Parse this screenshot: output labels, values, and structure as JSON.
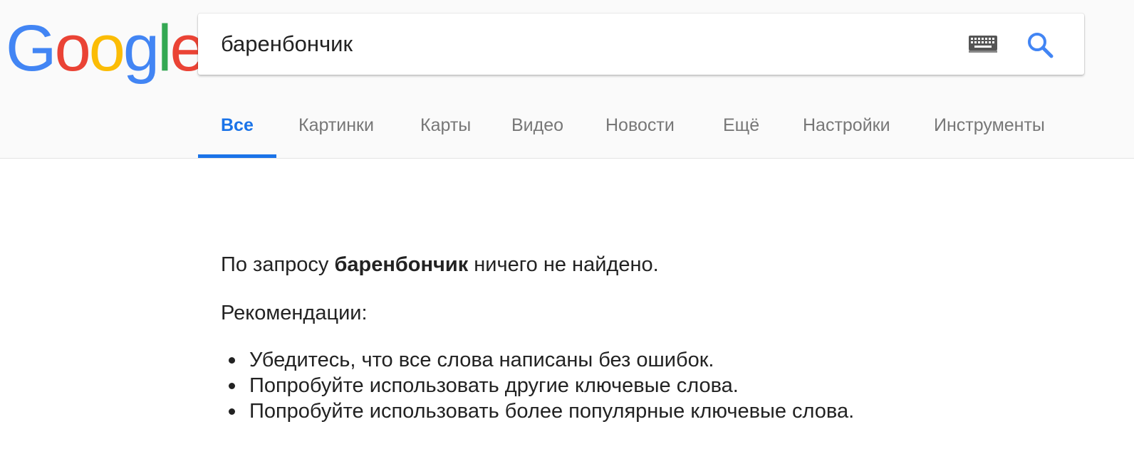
{
  "logo": {
    "letters": [
      "G",
      "o",
      "o",
      "g",
      "l",
      "e"
    ],
    "colors": [
      "#4285F4",
      "#EA4335",
      "#FBBC05",
      "#4285F4",
      "#34A853",
      "#EA4335"
    ]
  },
  "search": {
    "value": "баренбончик",
    "keyboard_icon": "keyboard-icon",
    "search_icon": "search-icon",
    "search_icon_color": "#4285F4"
  },
  "tabs": [
    {
      "label": "Все",
      "active": true
    },
    {
      "label": "Картинки"
    },
    {
      "label": "Карты"
    },
    {
      "label": "Видео"
    },
    {
      "label": "Новости"
    },
    {
      "label": "Ещё"
    },
    {
      "label": "Настройки"
    },
    {
      "label": "Инструменты"
    }
  ],
  "accent_color": "#1a73e8",
  "results": {
    "message_prefix": "По запросу",
    "query": "баренбончик",
    "message_suffix": "ничего не найдено.",
    "recommendations_title": "Рекомендации:",
    "suggestions": [
      "Убедитесь, что все слова написаны без ошибок.",
      "Попробуйте использовать другие ключевые слова.",
      "Попробуйте использовать более популярные ключевые слова."
    ]
  }
}
